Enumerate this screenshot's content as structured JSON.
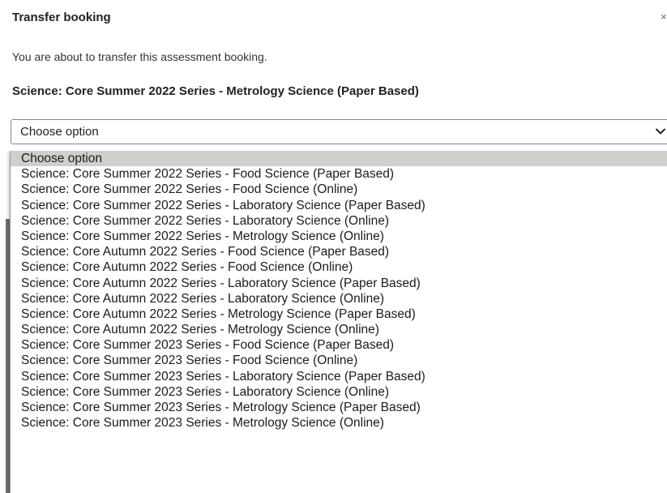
{
  "dialog": {
    "title": "Transfer booking",
    "close_glyph": "×",
    "message": "You are about to transfer this assessment booking.",
    "booking_name": "Science: Core Summer 2022 Series - Metrology Science (Paper Based)"
  },
  "select": {
    "value": "Choose option",
    "icon": "chevron-down-icon",
    "options": [
      "Choose option",
      "Science: Core Summer 2022 Series - Food Science (Paper Based)",
      "Science: Core Summer 2022 Series - Food Science (Online)",
      "Science: Core Summer 2022 Series - Laboratory Science (Paper Based)",
      "Science: Core Summer 2022 Series - Laboratory Science (Online)",
      "Science: Core Summer 2022 Series - Metrology Science (Online)",
      "Science: Core Autumn 2022 Series - Food Science (Paper Based)",
      "Science: Core Autumn 2022 Series - Food Science (Online)",
      "Science: Core Autumn 2022 Series - Laboratory Science (Paper Based)",
      "Science: Core Autumn 2022 Series - Laboratory Science (Online)",
      "Science: Core Autumn 2022 Series - Metrology Science (Paper Based)",
      "Science: Core Autumn 2022 Series - Metrology Science (Online)",
      "Science: Core Summer 2023 Series - Food Science (Paper Based)",
      "Science: Core Summer 2023 Series - Food Science (Online)",
      "Science: Core Summer 2023 Series - Laboratory Science (Paper Based)",
      "Science: Core Summer 2023 Series - Laboratory Science (Online)",
      "Science: Core Summer 2023 Series - Metrology Science (Paper Based)",
      "Science: Core Summer 2023 Series - Metrology Science (Online)"
    ],
    "selected_index": 0
  },
  "colors": {
    "select_border": "#6b8bb3",
    "highlight": "#cfcfcf",
    "text": "#1b1b1b"
  }
}
